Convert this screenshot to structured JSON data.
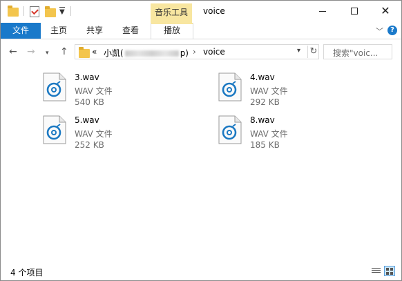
{
  "title_bar": {
    "context_tab_header": "音乐工具",
    "window_title": "voice",
    "minimize_glyph": "—",
    "maximize_glyph": "☐",
    "close_glyph": "✕"
  },
  "ribbon": {
    "file_tab": "文件",
    "tabs": [
      "主页",
      "共享",
      "查看",
      "播放"
    ]
  },
  "address_bar": {
    "chevrons": "«",
    "crumb_1_prefix": "小凯(",
    "crumb_1_suffix": "p)",
    "separator": "›",
    "crumb_2": "voice"
  },
  "search": {
    "placeholder": "搜索\"voic..."
  },
  "files": [
    {
      "name": "3.wav",
      "type": "WAV 文件",
      "size": "540 KB"
    },
    {
      "name": "4.wav",
      "type": "WAV 文件",
      "size": "292 KB"
    },
    {
      "name": "5.wav",
      "type": "WAV 文件",
      "size": "252 KB"
    },
    {
      "name": "8.wav",
      "type": "WAV 文件",
      "size": "185 KB"
    }
  ],
  "status_bar": {
    "item_count": "4 个项目"
  },
  "icons": {
    "quick_access_folder": "folder-icon",
    "properties": "properties-check-icon",
    "new_folder": "new-folder-icon",
    "file": "wav-audio-file-icon",
    "back": "arrow-left-icon",
    "forward": "arrow-right-icon",
    "recent": "chevron-down-icon",
    "up": "arrow-up-icon",
    "refresh": "refresh-icon",
    "search": "search-icon",
    "help": "help-icon",
    "details_view": "details-view-icon",
    "large_icons_view": "large-icons-view-icon"
  },
  "colors": {
    "accent": "#1979ca",
    "context_tab": "#f8e6a0",
    "folder": "#f3c54d",
    "secondary_text": "#6d6d6d"
  }
}
